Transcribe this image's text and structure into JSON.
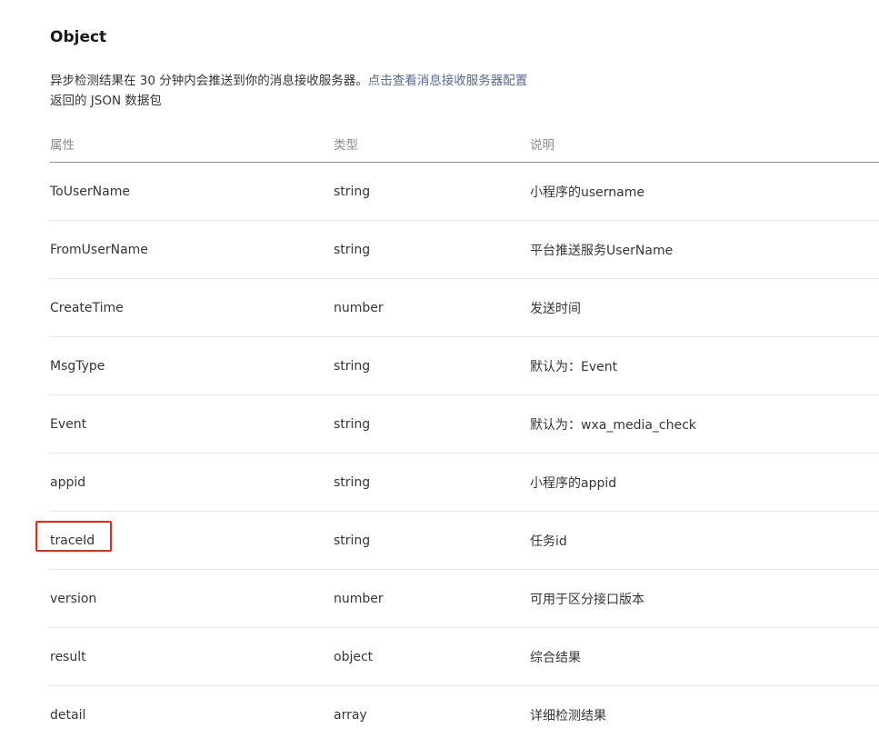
{
  "title": "Object",
  "description": {
    "line1_text": "异步检测结果在 30 分钟内会推送到你的消息接收服务器。",
    "line1_link": "点击查看消息接收服务器配置",
    "line2_text": "返回的 JSON 数据包"
  },
  "table": {
    "headers": [
      "属性",
      "类型",
      "说明"
    ],
    "rows": [
      {
        "name": "ToUserName",
        "type": "string",
        "desc": "小程序的username"
      },
      {
        "name": "FromUserName",
        "type": "string",
        "desc": "平台推送服务UserName"
      },
      {
        "name": "CreateTime",
        "type": "number",
        "desc": "发送时间"
      },
      {
        "name": "MsgType",
        "type": "string",
        "desc": "默认为：Event"
      },
      {
        "name": "Event",
        "type": "string",
        "desc": "默认为：wxa_media_check"
      },
      {
        "name": "appid",
        "type": "string",
        "desc": "小程序的appid"
      },
      {
        "name": "traceId",
        "type": "string",
        "desc": "任务id"
      },
      {
        "name": "version",
        "type": "number",
        "desc": "可用于区分接口版本"
      },
      {
        "name": "result",
        "type": "object",
        "desc": "综合结果"
      },
      {
        "name": "detail",
        "type": "array",
        "desc": "详细检测结果"
      }
    ]
  },
  "colors": {
    "link": "#576b95",
    "highlight_box": "#e8291c",
    "header_text": "#8c8c8c"
  }
}
